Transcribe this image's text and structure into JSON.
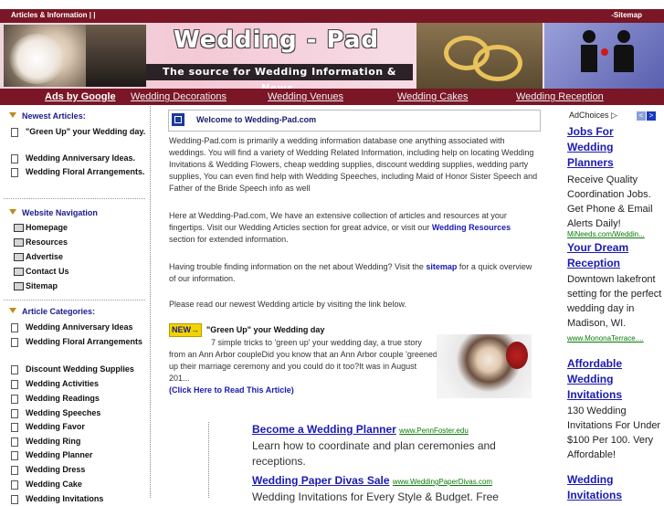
{
  "topbar": {
    "left": "Articles & Information | |",
    "right": "-Sitemap"
  },
  "banner": {
    "title": "Wedding - Pad",
    "tagline": "The source for Wedding Information & News."
  },
  "nav": {
    "ads": "Ads by Google",
    "links": [
      "Wedding Decorations",
      "Wedding Venues",
      "Wedding Cakes",
      "Wedding Reception"
    ]
  },
  "sidebar": {
    "newest_heading": "Newest Articles:",
    "newest": [
      "\"Green Up\" your Wedding day.",
      "Wedding Anniversary Ideas.",
      "Wedding Floral Arrangements."
    ],
    "nav_heading": "Website Navigation",
    "nav": [
      "Homepage",
      "Resources",
      "Advertise",
      "Contact Us",
      "Sitemap"
    ],
    "cat_heading": "Article Categories:",
    "categories": [
      "Wedding Anniversary Ideas",
      "Wedding Floral Arrangements",
      "Discount Wedding Supplies",
      "Wedding Activities",
      "Wedding Readings",
      "Wedding Speeches",
      "Wedding Favor",
      "Wedding Ring",
      "Wedding Planner",
      "Wedding Dress",
      "Wedding Cake",
      "Wedding Invitations"
    ]
  },
  "main": {
    "welcome": "Welcome to Wedding-Pad.com",
    "p1": "Wedding-Pad.com is primarily a wedding information database one anything associated with weddings. You will find a variety of  Wedding Related Information, including help on locating Wedding Invitations & Wedding Flowers, cheap wedding supplies, discount wedding supplies, wedding party supplies,  You can even find help with Wedding Speeches, including Maid of Honor Sister Speech and Father of the Bride Speech info as well",
    "p2a": "Here at Wedding-Pad.com, We have an extensive collection of articles and resources at your fingertips. Visit our Wedding Articles section for great advice, or visit our ",
    "p2link": "Wedding Resources",
    "p2b": " section for extended information.",
    "p3a": "Having trouble finding information on the net about Wedding? Visit the ",
    "p3link": "sitemap",
    "p3b": " for a quick overview of our information.",
    "p4": "Please read our newest Wedding article by visiting the link below.",
    "new_badge": "NEW",
    "article_title": "\"Green Up\" your Wedding day",
    "article_text": "7 simple tricks to 'green up' your wedding day, a true story from an Ann Arbor coupleDid you know that an Ann Arbor couple 'greened' up their marriage ceremony and you could do it too?It was in August 201...",
    "article_link": "(Click Here to Read This Article)"
  },
  "ads_center": [
    {
      "title": "Become a Wedding Planner",
      "url": "www.PennFoster.edu",
      "text": "Learn how to coordinate and plan ceremonies and receptions."
    },
    {
      "title": "Wedding Paper Divas Sale",
      "url": "www.WeddingPaperDivas.com",
      "text": "Wedding Invitations for Every Style & Budget. Free"
    }
  ],
  "ads_right": {
    "adchoices": "AdChoices",
    "items": [
      {
        "title": "Jobs For Wedding Planners",
        "text": "Receive Quality Coordination Jobs. Get Phone & Email Alerts Daily!",
        "url": "MiNeeds.com/Weddin..."
      },
      {
        "title": "Your Dream Reception",
        "text": "Downtown lakefront setting for the perfect wedding day in Madison, WI.",
        "url": "www.MononaTerrace...."
      },
      {
        "title": "Affordable Wedding Invitations",
        "text": "130 Wedding Invitations For Under $100 Per 100. Very Affordable!",
        "url": ""
      },
      {
        "title": "Wedding Invitations",
        "text": "",
        "url": ""
      }
    ]
  }
}
